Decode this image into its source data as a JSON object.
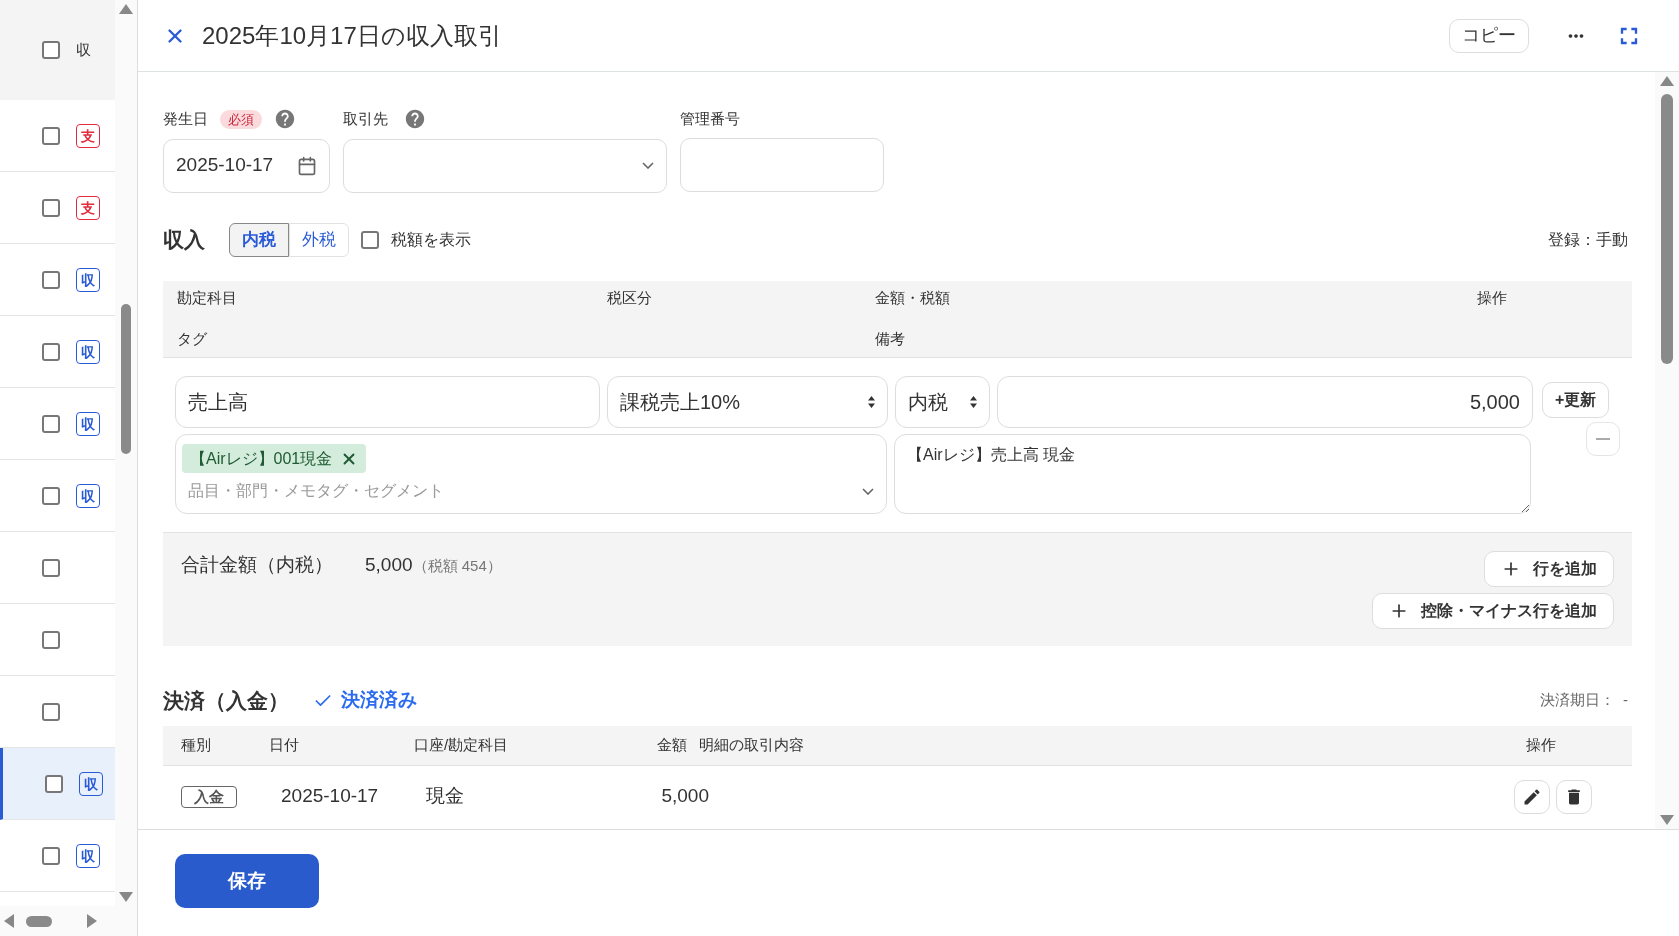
{
  "list_pane": {
    "header": {
      "checked": false,
      "column_label": "収"
    },
    "rows": [
      {
        "checked": false,
        "selected": false,
        "badge": {
          "text": "支",
          "color": "#e02b3c"
        }
      },
      {
        "checked": false,
        "selected": false,
        "badge": {
          "text": "支",
          "color": "#e02b3c"
        }
      },
      {
        "checked": false,
        "selected": false,
        "badge": {
          "text": "収",
          "color": "#2a5bd7"
        }
      },
      {
        "checked": false,
        "selected": false,
        "badge": {
          "text": "収",
          "color": "#2a5bd7"
        }
      },
      {
        "checked": false,
        "selected": false,
        "badge": {
          "text": "収",
          "color": "#2a5bd7"
        }
      },
      {
        "checked": false,
        "selected": false,
        "badge": {
          "text": "収",
          "color": "#2a5bd7"
        }
      },
      {
        "checked": false,
        "selected": false
      },
      {
        "checked": false,
        "selected": false
      },
      {
        "checked": false,
        "selected": false
      },
      {
        "checked": false,
        "selected": true,
        "badge": {
          "text": "収",
          "color": "#2a5bd7"
        }
      },
      {
        "checked": false,
        "selected": false,
        "badge": {
          "text": "収",
          "color": "#2a5bd7"
        }
      }
    ]
  },
  "panel": {
    "title": "2025年10月17日の収入取引",
    "copy_button": "コピー"
  },
  "fields": {
    "issue_date": {
      "label": "発生日",
      "required": "必須",
      "value": "2025-10-17"
    },
    "partner": {
      "label": "取引先"
    },
    "management_number": {
      "label": "管理番号"
    }
  },
  "income": {
    "title": "収入",
    "tax_modes": [
      {
        "label": "内税",
        "selected": true
      },
      {
        "label": "外税",
        "selected": false
      }
    ],
    "show_tax": {
      "label": "税額を表示",
      "checked": false
    },
    "registration": "登録：手動",
    "columns_line1": [
      "勘定科目",
      "税区分",
      "金額・税額",
      "操作"
    ],
    "columns_line2": [
      "タグ",
      "備考"
    ],
    "lines": [
      {
        "account": "売上高",
        "tax_category": "課税売上10%",
        "tax_mode": "内税",
        "amount": "5,000",
        "update_button": "+更新",
        "tags": [
          "【Airレジ】001現金"
        ],
        "tag_placeholder": "品目・部門・メモタグ・セグメント",
        "memo": "【Airレジ】売上高 現金"
      }
    ],
    "total_label": "合計金額（内税）",
    "total_amount": "5,000",
    "total_tax": "（税額 454）",
    "add_row_button": "行を追加",
    "add_deduction_button": "控除・マイナス行を追加"
  },
  "settlement": {
    "title": "決済（入金）",
    "settled": true,
    "status": "決済済み",
    "due_label": "決済期日：",
    "due_value": "-",
    "columns": [
      "種別",
      "日付",
      "口座/勘定科目",
      "金額",
      "明細の取引内容",
      "操作"
    ],
    "rows": [
      {
        "type": "入金",
        "date": "2025-10-17",
        "account": "現金",
        "amount": "5,000"
      }
    ]
  },
  "footer": {
    "save_button": "保存"
  }
}
